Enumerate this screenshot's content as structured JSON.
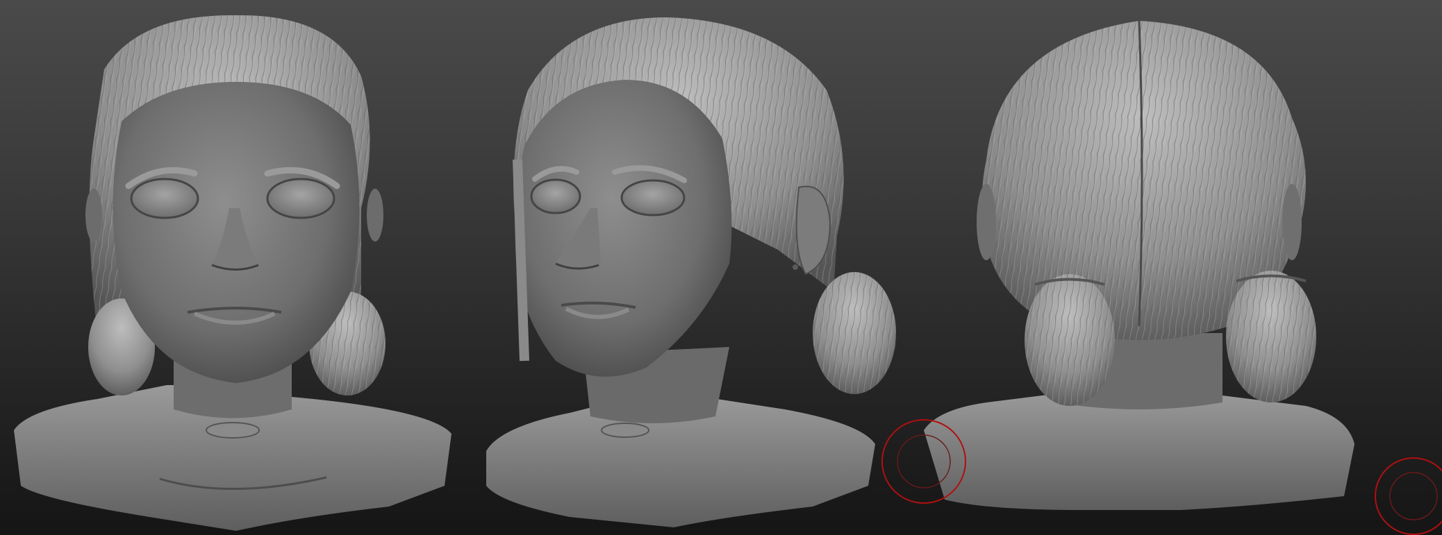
{
  "canvas": {
    "background_top": "#4a4a4a",
    "background_bottom": "#151515"
  },
  "views": [
    {
      "name": "front",
      "kind": "sculpt-view"
    },
    {
      "name": "three-quarter",
      "kind": "sculpt-view"
    },
    {
      "name": "back",
      "kind": "sculpt-view"
    }
  ],
  "colors": {
    "sculpt_clay": "#8a8a8a",
    "sculpt_shadow": "#4e4e4e",
    "sculpt_highlight": "#b8b8b8",
    "brush_cursor": "#b01010"
  },
  "icons": [
    "brush-cursor-icon"
  ]
}
